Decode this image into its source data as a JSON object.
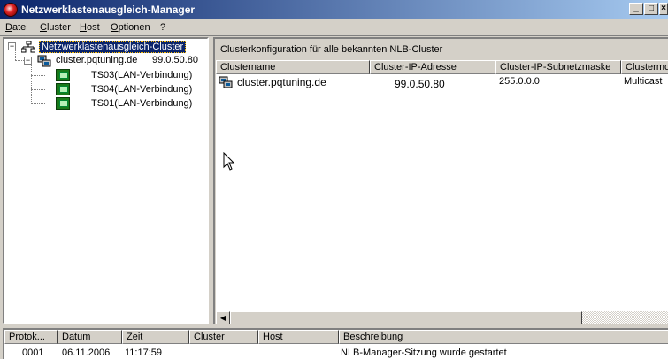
{
  "window": {
    "title": "Netzwerklastenausgleich-Manager",
    "min": "_",
    "max": "□",
    "close": "×"
  },
  "menu": [
    "Datei",
    "Cluster",
    "Host",
    "Optionen",
    "?"
  ],
  "tree": {
    "root": "Netzwerklastenausgleich-Cluster",
    "cluster": "cluster.pqtuning.de",
    "cluster_ip": "99.0.50.80",
    "hosts": [
      "TS03(LAN-Verbindung)",
      "TS04(LAN-Verbindung)",
      "TS01(LAN-Verbindung)"
    ]
  },
  "cluster_view": {
    "heading": "Clusterkonfiguration für alle bekannten NLB-Cluster",
    "columns": [
      "Clustername",
      "Cluster-IP-Adresse",
      "Cluster-IP-Subnetzmaske",
      "Clustermod"
    ],
    "rows": [
      {
        "name": "cluster.pqtuning.de",
        "ip": "99.0.50.80",
        "mask": "255.0.0.0",
        "mode": "Multicast"
      }
    ]
  },
  "log": {
    "columns": [
      "Protok...",
      "Datum",
      "Zeit",
      "Cluster",
      "Host",
      "Beschreibung"
    ],
    "rows": [
      {
        "id": "0001",
        "date": "06.11.2006",
        "time": "11:17:59",
        "cluster": "",
        "host": "",
        "desc": "NLB-Manager-Sitzung wurde gestartet"
      }
    ]
  },
  "icons": {
    "app": "nlb-manager-icon",
    "tree_root": "network-cluster-icon",
    "cluster": "cluster-icon",
    "host": "host-computer-icon"
  },
  "colors": {
    "titlebar": "#0a246a",
    "selection": "#0a246a",
    "window": "#d4d0c8"
  }
}
